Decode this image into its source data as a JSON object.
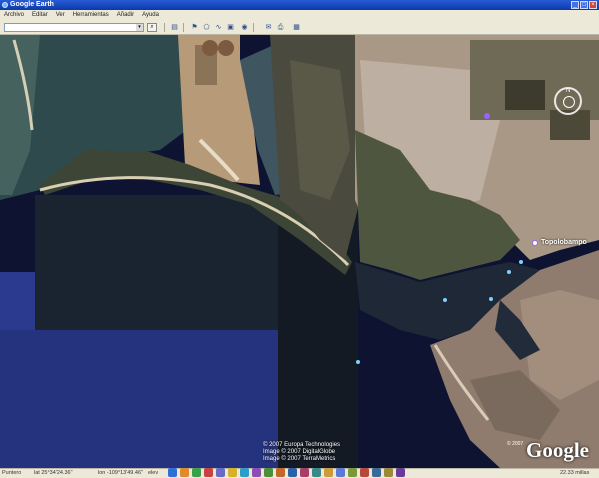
{
  "window": {
    "title": "Google Earth"
  },
  "menu": [
    "Archivo",
    "Editar",
    "Ver",
    "Herramientas",
    "Añadir",
    "Ayuda"
  ],
  "search": {
    "value": "",
    "dropdown_icon": "chevron-down-icon",
    "button_icon": "search-icon"
  },
  "toolbar_icons": [
    "sidebar-icon",
    "placemark-icon",
    "polygon-icon",
    "path-icon",
    "overlay-icon",
    "tour-icon",
    "email-icon",
    "print-icon",
    "view-in-maps-icon"
  ],
  "map": {
    "place_label": "Topolobampo",
    "credits": [
      "© 2007 Europa Technologies",
      "Image © 2007 DigitalGlobe",
      "Image © 2007 TerraMetrics"
    ],
    "logo": "Google",
    "compass_label": "N",
    "copyright_mark": "© 2007"
  },
  "status": {
    "pointer": "Puntero",
    "lat": "lat  25°34'24.36\"",
    "lon": "lon  -109°13'49.46\"",
    "elev": "elev",
    "eye_alt": "22.33 millas"
  },
  "colors": {
    "titlebar": "#0a3aa8",
    "chrome": "#ece9d8",
    "water": "#1b2a6e"
  }
}
